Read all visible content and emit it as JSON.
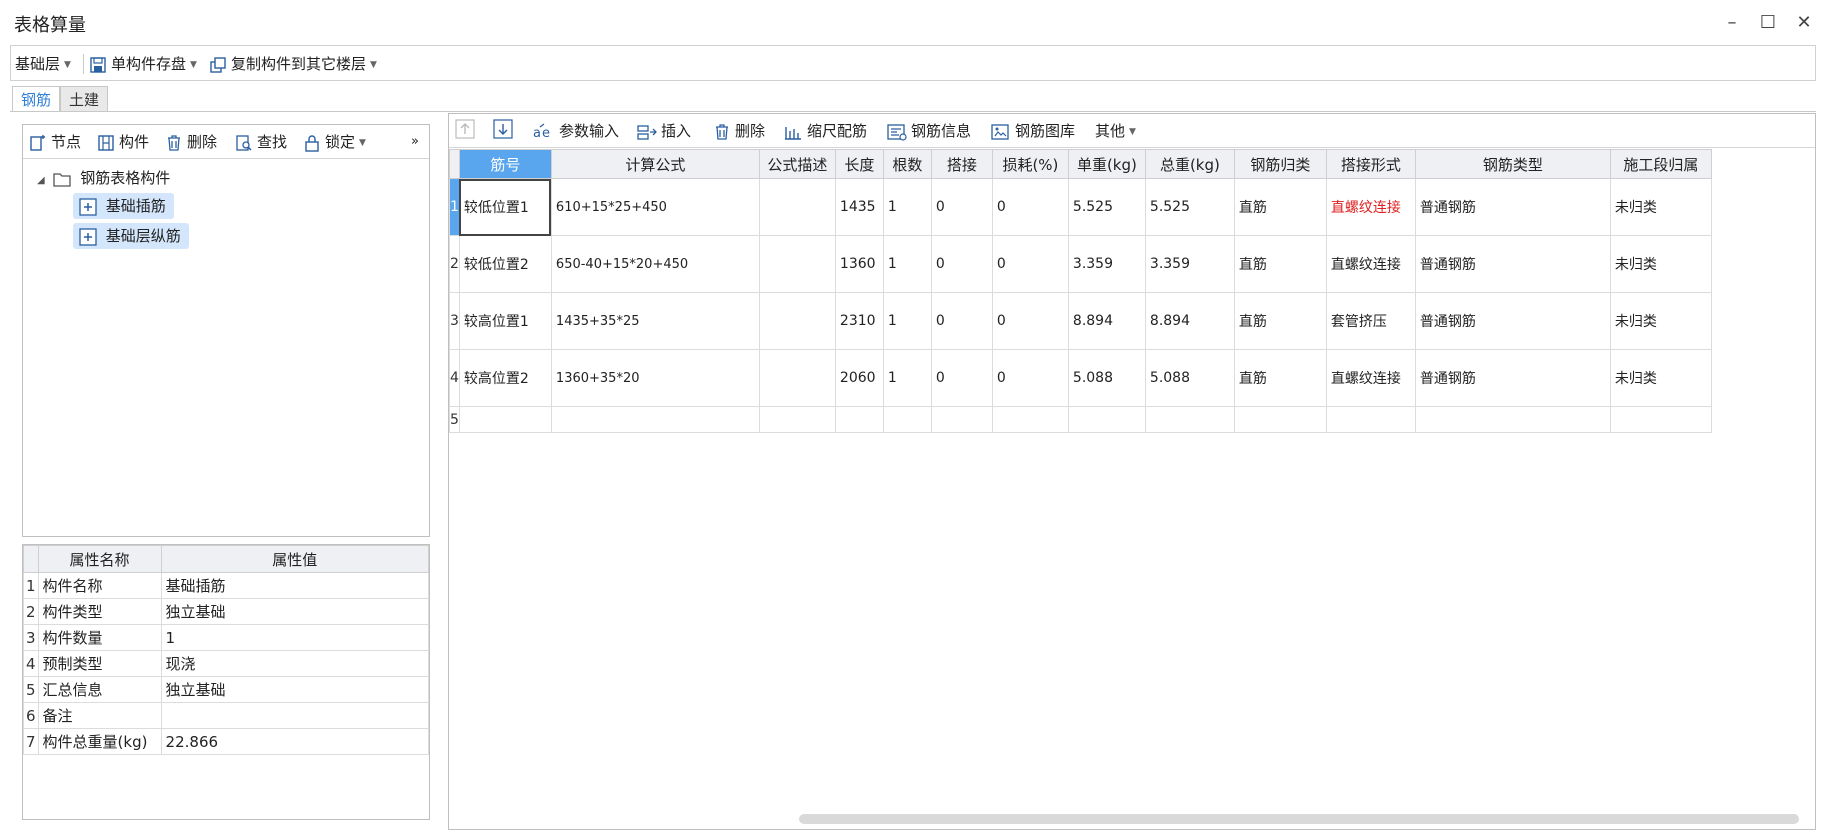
{
  "window": {
    "title": "表格算量",
    "minimize": "–",
    "maximize": "☐",
    "close": "✕"
  },
  "toolbar": {
    "floor": "基础层",
    "save_component": "单构件存盘",
    "copy_to_floor": "复制构件到其它楼层"
  },
  "tabs": {
    "rebar": "钢筋",
    "civil": "土建"
  },
  "left_toolbar": {
    "node": "节点",
    "component": "构件",
    "delete": "删除",
    "find": "查找",
    "lock": "锁定",
    "more": "»"
  },
  "tree": {
    "root": "钢筋表格构件",
    "children": [
      "基础插筋",
      "基础层纵筋"
    ]
  },
  "props": {
    "headers": {
      "name": "属性名称",
      "value": "属性值"
    },
    "rows": [
      {
        "n": "1",
        "name": "构件名称",
        "value": "基础插筋"
      },
      {
        "n": "2",
        "name": "构件类型",
        "value": "独立基础"
      },
      {
        "n": "3",
        "name": "构件数量",
        "value": "1"
      },
      {
        "n": "4",
        "name": "预制类型",
        "value": "现浇"
      },
      {
        "n": "5",
        "name": "汇总信息",
        "value": "独立基础"
      },
      {
        "n": "6",
        "name": "备注",
        "value": ""
      },
      {
        "n": "7",
        "name": "构件总重量(kg)",
        "value": "22.866"
      }
    ]
  },
  "right_toolbar": {
    "param_input": "参数输入",
    "insert": "插入",
    "delete": "删除",
    "scale_rebar": "缩尺配筋",
    "rebar_info": "钢筋信息",
    "rebar_library": "钢筋图库",
    "other": "其他"
  },
  "grid": {
    "headers": [
      "筋号",
      "计算公式",
      "公式描述",
      "长度",
      "根数",
      "搭接",
      "损耗(%)",
      "单重(kg)",
      "总重(kg)",
      "钢筋归类",
      "搭接形式",
      "钢筋类型",
      "施工段归属"
    ],
    "rows": [
      {
        "n": "1",
        "cells": [
          "较低位置1",
          "610+15*25+450",
          "",
          "1435",
          "1",
          "0",
          "0",
          "5.525",
          "5.525",
          "直筋",
          "直螺纹连接",
          "普通钢筋",
          "未归类"
        ]
      },
      {
        "n": "2",
        "cells": [
          "较低位置2",
          "650-40+15*20+450",
          "",
          "1360",
          "1",
          "0",
          "0",
          "3.359",
          "3.359",
          "直筋",
          "直螺纹连接",
          "普通钢筋",
          "未归类"
        ]
      },
      {
        "n": "3",
        "cells": [
          "较高位置1",
          "1435+35*25",
          "",
          "2310",
          "1",
          "0",
          "0",
          "8.894",
          "8.894",
          "直筋",
          "套管挤压",
          "普通钢筋",
          "未归类"
        ]
      },
      {
        "n": "4",
        "cells": [
          "较高位置2",
          "1360+35*20",
          "",
          "2060",
          "1",
          "0",
          "0",
          "5.088",
          "5.088",
          "直筋",
          "直螺纹连接",
          "普通钢筋",
          "未归类"
        ]
      },
      {
        "n": "5",
        "cells": [
          "",
          "",
          "",
          "",
          "",
          "",
          "",
          "",
          "",
          "",
          "",
          "",
          ""
        ]
      }
    ]
  },
  "colors": {
    "accent": "#5aa6ee",
    "tab_active": "#2f7fd8",
    "error_text": "#e02020",
    "selected_tree": "#d4e6fb"
  }
}
